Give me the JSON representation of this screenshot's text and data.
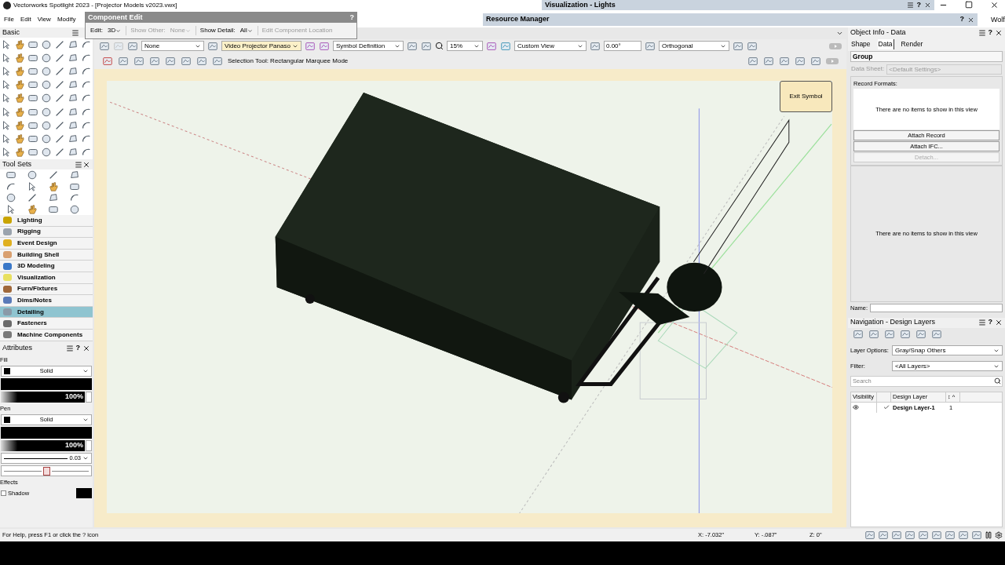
{
  "window": {
    "title": "Vectorworks Spotlight 2023 - [Projector Models v2023.vwx]"
  },
  "menu": [
    "File",
    "Edit",
    "View",
    "Modify"
  ],
  "component_edit": {
    "title": "Component Edit",
    "help": "?",
    "edit_label": "Edit:",
    "edit_value": "3D",
    "show_other_label": "Show Other:",
    "show_other_value": "None",
    "show_detail_label": "Show Detail:",
    "show_detail_value": "All",
    "location_button": "Edit Component Location"
  },
  "visualization_palette": {
    "title": "Visualization - Lights",
    "help": "?"
  },
  "resource_manager": {
    "title": "Resource Manager",
    "help": "?"
  },
  "cut_text": "Wolf",
  "view_bar": {
    "class_value": "None",
    "layer_value": "Video Projector Panaso",
    "mode_value": "Symbol Definition",
    "zoom_value": "15%",
    "view_value": "Custom View",
    "angle_value": "0.00°",
    "projection_value": "Orthogonal",
    "status_text": "Selection Tool: Rectangular Marquee Mode"
  },
  "basic_palette": {
    "title": "Basic"
  },
  "tool_sets": {
    "title": "Tool Sets",
    "items": [
      {
        "label": "Lighting",
        "selected": false,
        "color": "#c9a400"
      },
      {
        "label": "Rigging",
        "selected": false,
        "color": "#9aa3ad"
      },
      {
        "label": "Event Design",
        "selected": false,
        "color": "#e0b020"
      },
      {
        "label": "Building Shell",
        "selected": false,
        "color": "#d9a070"
      },
      {
        "label": "3D Modeling",
        "selected": false,
        "color": "#3a78c8"
      },
      {
        "label": "Visualization",
        "selected": false,
        "color": "#e8e060"
      },
      {
        "label": "Furn/Fixtures",
        "selected": false,
        "color": "#a0683a"
      },
      {
        "label": "Dims/Notes",
        "selected": false,
        "color": "#5a7ab8"
      },
      {
        "label": "Detailing",
        "selected": true,
        "color": "#8a9aa8"
      },
      {
        "label": "Fasteners",
        "selected": false,
        "color": "#6a6a6a"
      },
      {
        "label": "Machine Components",
        "selected": false,
        "color": "#7a7a7a"
      }
    ]
  },
  "attributes": {
    "title": "Attributes",
    "help": "?",
    "fill_label": "Fill",
    "fill_style": "Solid",
    "fill_opacity": "100%",
    "pen_label": "Pen",
    "pen_style": "Solid",
    "pen_opacity": "100%",
    "line_weight": "0.03",
    "effects_label": "Effects",
    "shadow": {
      "label": "Shadow",
      "checked": false
    }
  },
  "canvas": {
    "exit_button": "Exit Symbol"
  },
  "object_info": {
    "title": "Object Info - Data",
    "help": "?",
    "tabs": [
      {
        "label": "Shape",
        "selected": false
      },
      {
        "label": "Data",
        "selected": true
      },
      {
        "label": "Render",
        "selected": false
      }
    ],
    "group_label": "Group",
    "data_sheet_label": "Data Sheet:",
    "data_sheet_value": "<Default Settings>",
    "record_formats_label": "Record Formats:",
    "empty_text": "There are no items to show in this view",
    "buttons": [
      {
        "label": "Attach Record",
        "disabled": false
      },
      {
        "label": "Attach IFC...",
        "disabled": false
      },
      {
        "label": "Detach...",
        "disabled": true
      }
    ],
    "empty_text_2": "There are no items to show in this view",
    "name_label": "Name:"
  },
  "navigation": {
    "title": "Navigation - Design Layers",
    "help": "?",
    "layer_options_label": "Layer Options:",
    "layer_options_value": "Gray/Snap Others",
    "filter_label": "Filter:",
    "filter_value": "<All Layers>",
    "search_placeholder": "Search",
    "columns": [
      "Visibility",
      "Design Layer",
      "↕ ^"
    ],
    "rows": [
      {
        "name": "Design Layer-1",
        "active": true,
        "number": "1"
      }
    ]
  },
  "status_bar": {
    "help_text": "For Help, press F1 or click the ? icon",
    "x": "X: -7.032\"",
    "y": "Y: -.087\"",
    "z": "Z: 0\""
  }
}
